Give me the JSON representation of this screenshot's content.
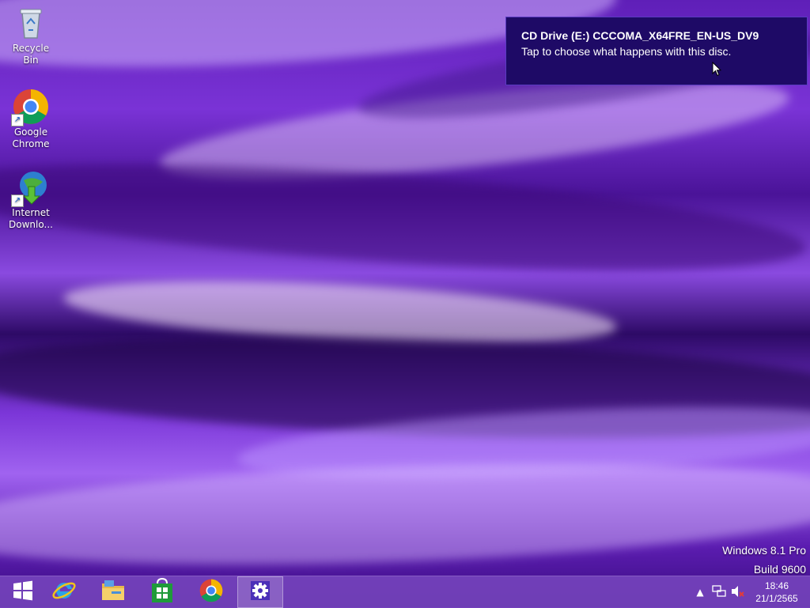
{
  "desktop": {
    "icons": [
      {
        "label": "Recycle Bin",
        "icon": "recycle-bin-icon"
      },
      {
        "label": "Google Chrome",
        "icon": "chrome-icon"
      },
      {
        "label": "Internet Downlo...",
        "icon": "internet-download-manager-icon"
      }
    ]
  },
  "notification": {
    "title": "CD Drive (E:) CCCOMA_X64FRE_EN-US_DV9",
    "message": "Tap to choose what happens with this disc."
  },
  "watermark": {
    "line1": "Windows 8.1 Pro",
    "line2": "Build 9600"
  },
  "taskbar": {
    "pinned": [
      {
        "name": "start",
        "icon": "windows-logo-icon"
      },
      {
        "name": "internet-explorer",
        "icon": "internet-explorer-icon"
      },
      {
        "name": "file-explorer",
        "icon": "file-explorer-icon"
      },
      {
        "name": "store",
        "icon": "store-icon"
      },
      {
        "name": "chrome",
        "icon": "chrome-icon"
      },
      {
        "name": "settings",
        "icon": "gear-icon"
      }
    ],
    "tray": {
      "icons": [
        "chevron-up-icon",
        "network-icon",
        "volume-muted-icon"
      ]
    },
    "clock": {
      "time": "18:46",
      "date": "21/1/2565"
    }
  },
  "colors": {
    "accent": "#7b36d8",
    "toast_bg": "#1e0a66",
    "taskbar": "#7846be"
  }
}
